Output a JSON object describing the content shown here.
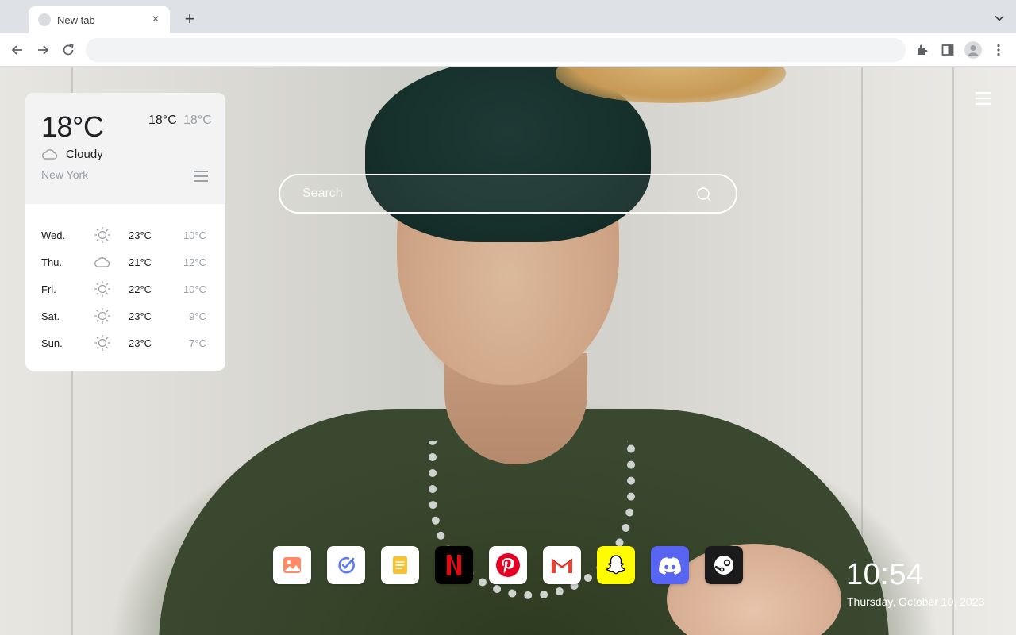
{
  "browser": {
    "tab_title": "New tab",
    "tab_close": "×",
    "new_tab": "+",
    "omnibox_value": "",
    "omnibox_placeholder": ""
  },
  "weather": {
    "current_temp": "18°C",
    "range_high": "18°C",
    "range_low": "18°C",
    "condition": "Cloudy",
    "condition_icon": "cloud-icon",
    "city": "New York",
    "forecast": [
      {
        "day": "Wed.",
        "icon": "sun-icon",
        "high": "23°C",
        "low": "10°C"
      },
      {
        "day": "Thu.",
        "icon": "cloud-icon",
        "high": "21°C",
        "low": "12°C"
      },
      {
        "day": "Fri.",
        "icon": "sun-icon",
        "high": "22°C",
        "low": "10°C"
      },
      {
        "day": "Sat.",
        "icon": "sun-icon",
        "high": "23°C",
        "low": "9°C"
      },
      {
        "day": "Sun.",
        "icon": "sun-icon",
        "high": "23°C",
        "low": "7°C"
      }
    ]
  },
  "search": {
    "placeholder": "Search"
  },
  "dock": [
    {
      "name": "gallery",
      "icon": "image-icon",
      "bg": "#ffffff"
    },
    {
      "name": "tasks",
      "icon": "check-circle-icon",
      "bg": "#ffffff"
    },
    {
      "name": "notes",
      "icon": "note-icon",
      "bg": "#ffffff"
    },
    {
      "name": "netflix",
      "icon": "netflix-icon",
      "bg": "#000000"
    },
    {
      "name": "pinterest",
      "icon": "pinterest-icon",
      "bg": "#ffffff"
    },
    {
      "name": "gmail",
      "icon": "gmail-icon",
      "bg": "#ffffff"
    },
    {
      "name": "snapchat",
      "icon": "snapchat-icon",
      "bg": "#fffc00"
    },
    {
      "name": "discord",
      "icon": "discord-icon",
      "bg": "#5865f2"
    },
    {
      "name": "steam",
      "icon": "steam-icon",
      "bg": "#1b1b1b"
    }
  ],
  "clock": {
    "time": "10:54",
    "date": "Thursday, October 10, 2023"
  }
}
